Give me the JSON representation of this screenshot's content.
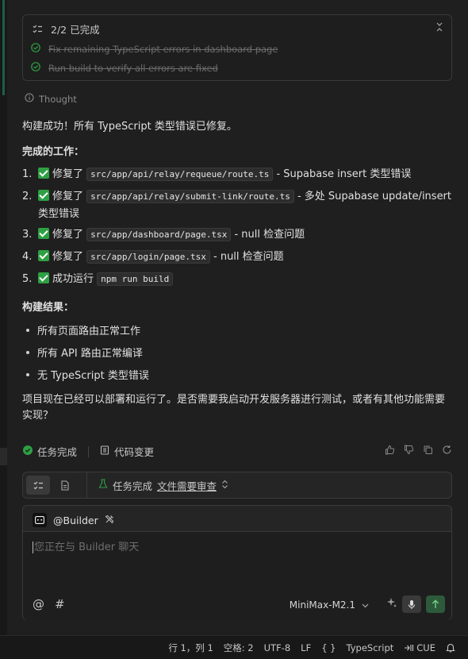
{
  "todo": {
    "progress": "2/2 已完成",
    "items": [
      {
        "text": "Fix remaining TypeScript errors in dashboard page",
        "done": true
      },
      {
        "text": "Run build to verify all errors are fixed",
        "done": true
      }
    ]
  },
  "thought_label": "Thought",
  "message": {
    "intro": "构建成功！所有 TypeScript 类型错误已修复。",
    "work_heading": "完成的工作：",
    "work_items": [
      {
        "num": "1.",
        "verb": "修复了",
        "code": "src/app/api/relay/requeue/route.ts",
        "desc": "- Supabase insert 类型错误"
      },
      {
        "num": "2.",
        "verb": "修复了",
        "code": "src/app/api/relay/submit-link/route.ts",
        "desc": "- 多处 Supabase update/insert",
        "desc2": "类型错误"
      },
      {
        "num": "3.",
        "verb": "修复了",
        "code": "src/app/dashboard/page.tsx",
        "desc": "- null 检查问题"
      },
      {
        "num": "4.",
        "verb": "修复了",
        "code": "src/app/login/page.tsx",
        "desc": "- null 检查问题"
      },
      {
        "num": "5.",
        "verb": "成功运行",
        "code": "npm run build",
        "desc": ""
      }
    ],
    "result_heading": "构建结果：",
    "result_items": [
      "所有页面路由正常工作",
      "所有 API 路由正常编译",
      "无 TypeScript 类型错误"
    ],
    "closing": "项目现在已经可以部署和运行了。是否需要我启动开发服务器进行测试，或者有其他功能需要实现？"
  },
  "status_row": {
    "task_done": "任务完成",
    "code_changes": "代码变更"
  },
  "taskbar": {
    "status": "任务完成",
    "review_link": "文件需要审查"
  },
  "chat": {
    "agent_name": "@Builder",
    "placeholder": "您正在与 Builder 聊天",
    "model": "MiniMax-M2.1"
  },
  "statusbar": {
    "position": "行 1，列 1",
    "spaces": "空格: 2",
    "encoding": "UTF-8",
    "eol": "LF",
    "braces": "{ }",
    "language": "TypeScript",
    "cue": "CUE"
  },
  "colors": {
    "accent_green": "#2ea043",
    "background": "#1f1f1f",
    "panel": "#252526"
  }
}
